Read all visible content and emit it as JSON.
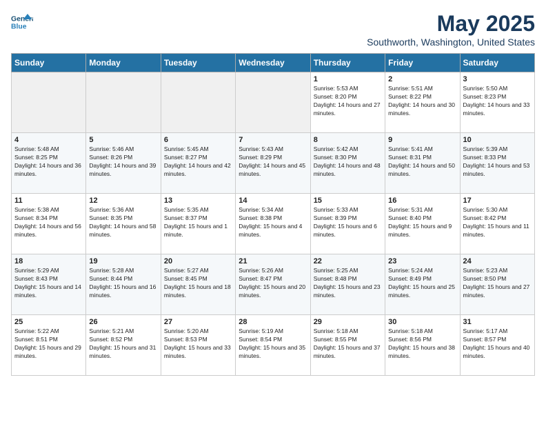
{
  "header": {
    "logo_line1": "General",
    "logo_line2": "Blue",
    "title": "May 2025",
    "subtitle": "Southworth, Washington, United States"
  },
  "weekdays": [
    "Sunday",
    "Monday",
    "Tuesday",
    "Wednesday",
    "Thursday",
    "Friday",
    "Saturday"
  ],
  "weeks": [
    [
      {
        "day": "",
        "empty": true
      },
      {
        "day": "",
        "empty": true
      },
      {
        "day": "",
        "empty": true
      },
      {
        "day": "",
        "empty": true
      },
      {
        "day": "1",
        "sunrise": "5:53 AM",
        "sunset": "8:20 PM",
        "daylight": "14 hours and 27 minutes."
      },
      {
        "day": "2",
        "sunrise": "5:51 AM",
        "sunset": "8:22 PM",
        "daylight": "14 hours and 30 minutes."
      },
      {
        "day": "3",
        "sunrise": "5:50 AM",
        "sunset": "8:23 PM",
        "daylight": "14 hours and 33 minutes."
      }
    ],
    [
      {
        "day": "4",
        "sunrise": "5:48 AM",
        "sunset": "8:25 PM",
        "daylight": "14 hours and 36 minutes."
      },
      {
        "day": "5",
        "sunrise": "5:46 AM",
        "sunset": "8:26 PM",
        "daylight": "14 hours and 39 minutes."
      },
      {
        "day": "6",
        "sunrise": "5:45 AM",
        "sunset": "8:27 PM",
        "daylight": "14 hours and 42 minutes."
      },
      {
        "day": "7",
        "sunrise": "5:43 AM",
        "sunset": "8:29 PM",
        "daylight": "14 hours and 45 minutes."
      },
      {
        "day": "8",
        "sunrise": "5:42 AM",
        "sunset": "8:30 PM",
        "daylight": "14 hours and 48 minutes."
      },
      {
        "day": "9",
        "sunrise": "5:41 AM",
        "sunset": "8:31 PM",
        "daylight": "14 hours and 50 minutes."
      },
      {
        "day": "10",
        "sunrise": "5:39 AM",
        "sunset": "8:33 PM",
        "daylight": "14 hours and 53 minutes."
      }
    ],
    [
      {
        "day": "11",
        "sunrise": "5:38 AM",
        "sunset": "8:34 PM",
        "daylight": "14 hours and 56 minutes."
      },
      {
        "day": "12",
        "sunrise": "5:36 AM",
        "sunset": "8:35 PM",
        "daylight": "14 hours and 58 minutes."
      },
      {
        "day": "13",
        "sunrise": "5:35 AM",
        "sunset": "8:37 PM",
        "daylight": "15 hours and 1 minute."
      },
      {
        "day": "14",
        "sunrise": "5:34 AM",
        "sunset": "8:38 PM",
        "daylight": "15 hours and 4 minutes."
      },
      {
        "day": "15",
        "sunrise": "5:33 AM",
        "sunset": "8:39 PM",
        "daylight": "15 hours and 6 minutes."
      },
      {
        "day": "16",
        "sunrise": "5:31 AM",
        "sunset": "8:40 PM",
        "daylight": "15 hours and 9 minutes."
      },
      {
        "day": "17",
        "sunrise": "5:30 AM",
        "sunset": "8:42 PM",
        "daylight": "15 hours and 11 minutes."
      }
    ],
    [
      {
        "day": "18",
        "sunrise": "5:29 AM",
        "sunset": "8:43 PM",
        "daylight": "15 hours and 14 minutes."
      },
      {
        "day": "19",
        "sunrise": "5:28 AM",
        "sunset": "8:44 PM",
        "daylight": "15 hours and 16 minutes."
      },
      {
        "day": "20",
        "sunrise": "5:27 AM",
        "sunset": "8:45 PM",
        "daylight": "15 hours and 18 minutes."
      },
      {
        "day": "21",
        "sunrise": "5:26 AM",
        "sunset": "8:47 PM",
        "daylight": "15 hours and 20 minutes."
      },
      {
        "day": "22",
        "sunrise": "5:25 AM",
        "sunset": "8:48 PM",
        "daylight": "15 hours and 23 minutes."
      },
      {
        "day": "23",
        "sunrise": "5:24 AM",
        "sunset": "8:49 PM",
        "daylight": "15 hours and 25 minutes."
      },
      {
        "day": "24",
        "sunrise": "5:23 AM",
        "sunset": "8:50 PM",
        "daylight": "15 hours and 27 minutes."
      }
    ],
    [
      {
        "day": "25",
        "sunrise": "5:22 AM",
        "sunset": "8:51 PM",
        "daylight": "15 hours and 29 minutes."
      },
      {
        "day": "26",
        "sunrise": "5:21 AM",
        "sunset": "8:52 PM",
        "daylight": "15 hours and 31 minutes."
      },
      {
        "day": "27",
        "sunrise": "5:20 AM",
        "sunset": "8:53 PM",
        "daylight": "15 hours and 33 minutes."
      },
      {
        "day": "28",
        "sunrise": "5:19 AM",
        "sunset": "8:54 PM",
        "daylight": "15 hours and 35 minutes."
      },
      {
        "day": "29",
        "sunrise": "5:18 AM",
        "sunset": "8:55 PM",
        "daylight": "15 hours and 37 minutes."
      },
      {
        "day": "30",
        "sunrise": "5:18 AM",
        "sunset": "8:56 PM",
        "daylight": "15 hours and 38 minutes."
      },
      {
        "day": "31",
        "sunrise": "5:17 AM",
        "sunset": "8:57 PM",
        "daylight": "15 hours and 40 minutes."
      }
    ]
  ],
  "labels": {
    "sunrise": "Sunrise:",
    "sunset": "Sunset:",
    "daylight": "Daylight:"
  }
}
